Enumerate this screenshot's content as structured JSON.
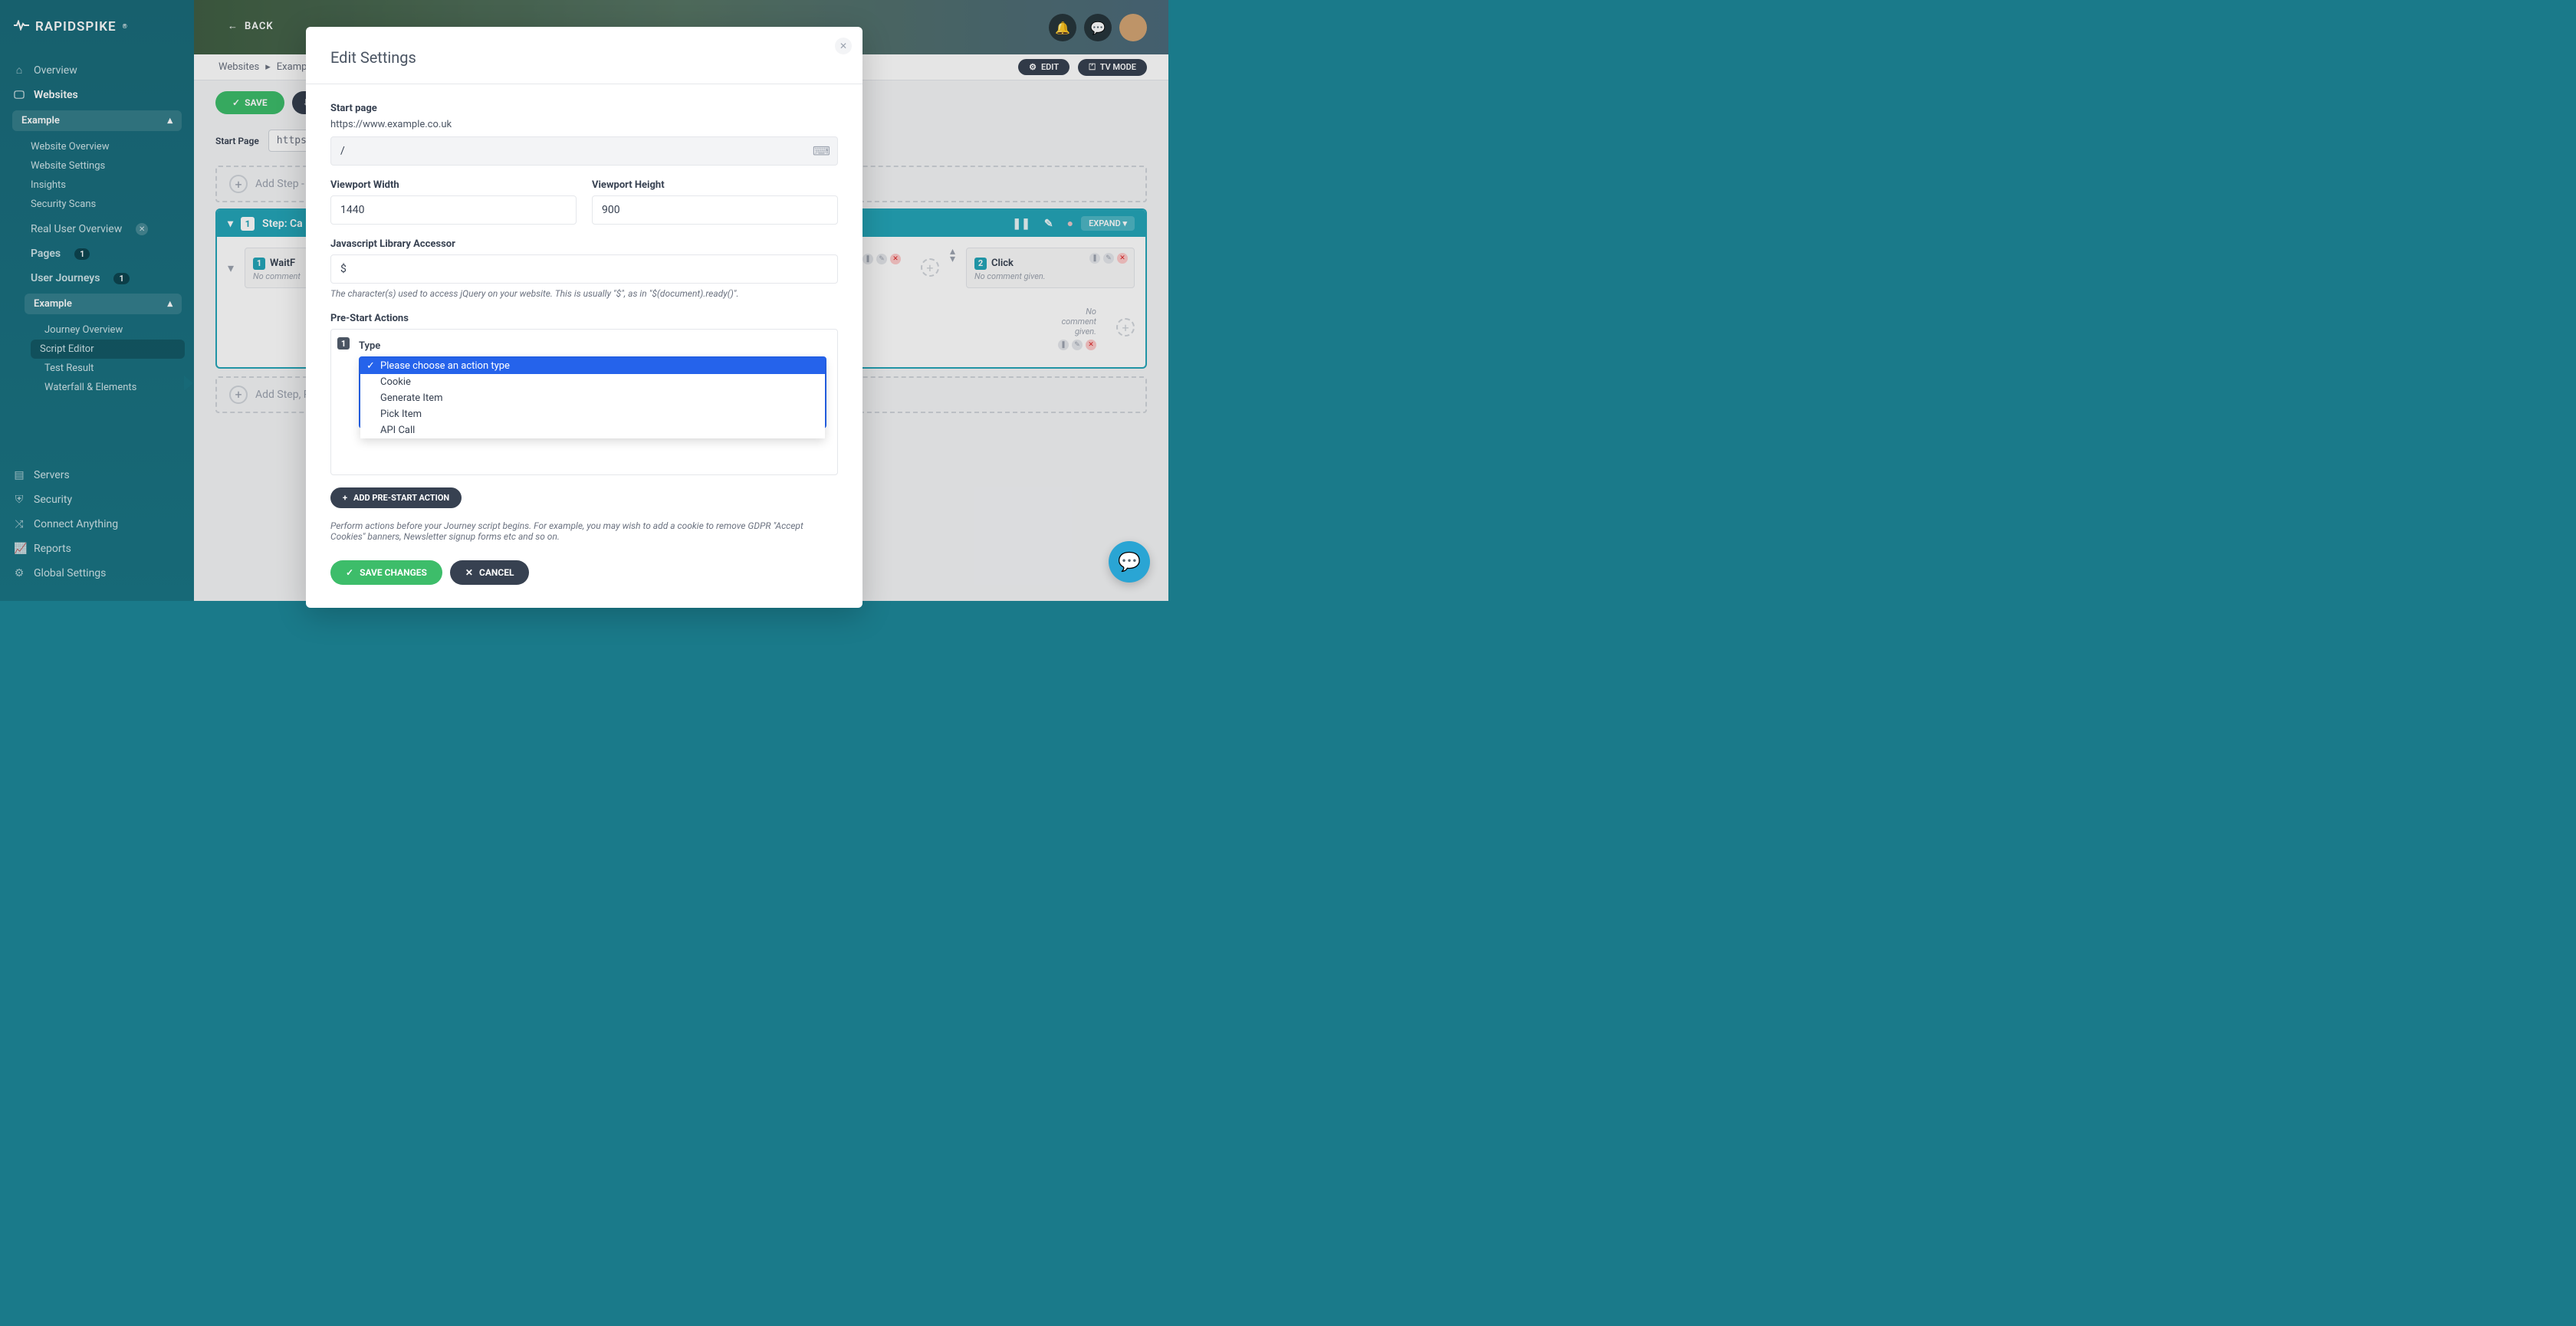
{
  "brand": "RAPIDSPIKE",
  "sidebar": {
    "overview": "Overview",
    "websites": "Websites",
    "example": "Example",
    "website_nav": [
      "Website Overview",
      "Website Settings",
      "Insights",
      "Security Scans"
    ],
    "real_user": "Real User Overview",
    "pages": "Pages",
    "pages_badge": "1",
    "user_journeys": "User Journeys",
    "uj_badge": "1",
    "uj_example": "Example",
    "uj_nav": [
      "Journey Overview",
      "Script Editor",
      "Test Result",
      "Waterfall & Elements"
    ],
    "active_index": 1,
    "servers": "Servers",
    "security": "Security",
    "connect": "Connect Anything",
    "reports": "Reports",
    "global": "Global Settings"
  },
  "header": {
    "back": "BACK",
    "crumb1": "Websites",
    "crumb2": "Exampl",
    "edit": "EDIT",
    "tv": "TV MODE"
  },
  "toolbar": {
    "save": "SAVE",
    "start_page_label": "Start Page",
    "start_page_value": "https:/"
  },
  "canvas": {
    "add_step_pre": "Add Step - F",
    "step1_title": "Step: Ca",
    "expand": "EXPAND",
    "action1": {
      "title": "WaitF",
      "comment": "No comment"
    },
    "action1b": {
      "comment": "No comment given."
    },
    "action2": {
      "num": "2",
      "title": "Click",
      "comment": "No comment given."
    },
    "add_step_post": "Add Step, P"
  },
  "modal": {
    "title": "Edit Settings",
    "start_page_label": "Start page",
    "start_page_url": "https://www.example.co.uk",
    "start_page_value": "/",
    "viewport_width_label": "Viewport Width",
    "viewport_width_value": "1440",
    "viewport_height_label": "Viewport Height",
    "viewport_height_value": "900",
    "js_accessor_label": "Javascript Library Accessor",
    "js_accessor_value": "$",
    "js_accessor_help": "The character(s) used to access jQuery on your website. This is usually \"$\", as in \"$(document).ready()\".",
    "prestart_label": "Pre-Start Actions",
    "prestart_num": "1",
    "type_label": "Type",
    "dropdown_options": [
      "Please choose an action type",
      "Cookie",
      "Generate Item",
      "Pick Item",
      "API Call"
    ],
    "add_prestart": "ADD PRE-START ACTION",
    "prestart_help": "Perform actions before your Journey script begins. For example, you may wish to add a cookie to remove GDPR \"Accept Cookies\" banners, Newsletter signup forms etc and so on.",
    "save_changes": "SAVE CHANGES",
    "cancel": "CANCEL"
  }
}
